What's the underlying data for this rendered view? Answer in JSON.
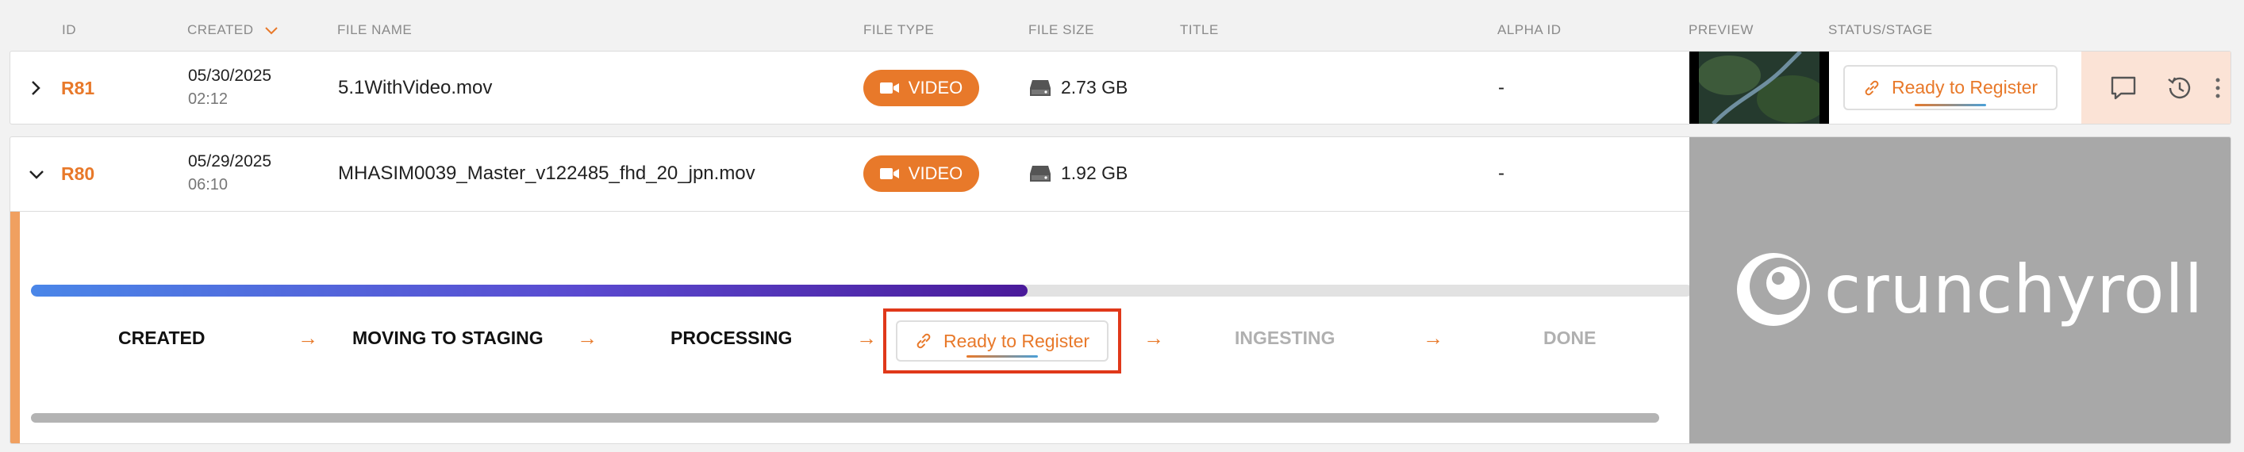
{
  "headers": {
    "id": "ID",
    "created": "CREATED",
    "file_name": "FILE NAME",
    "file_type": "FILE TYPE",
    "file_size": "FILE SIZE",
    "title": "TITLE",
    "alpha_id": "ALPHA ID",
    "preview": "PREVIEW",
    "status": "STATUS/STAGE",
    "sort_icon": "chevron-down-icon"
  },
  "rows": [
    {
      "id": "R81",
      "date": "05/30/2025",
      "time": "02:12",
      "file_name": "5.1WithVideo.mov",
      "file_type": "VIDEO",
      "file_size": "2.73 GB",
      "title": "",
      "alpha_id": "-",
      "status": "Ready to Register",
      "expanded": false
    },
    {
      "id": "R80",
      "date": "05/29/2025",
      "time": "06:10",
      "file_name": "MHASIM0039_Master_v122485_fhd_20_jpn.mov",
      "file_type": "VIDEO",
      "file_size": "1.92 GB",
      "title": "",
      "alpha_id": "-",
      "expanded": true
    }
  ],
  "pipeline": {
    "progress": 0.6,
    "stages": [
      {
        "label": "CREATED",
        "state": "done"
      },
      {
        "label": "MOVING TO STAGING",
        "state": "done"
      },
      {
        "label": "PROCESSING",
        "state": "done"
      },
      {
        "label": "Ready to Register",
        "state": "current"
      },
      {
        "label": "INGESTING",
        "state": "pending"
      },
      {
        "label": "DONE",
        "state": "pending"
      }
    ]
  },
  "brand": {
    "logo_text": "crunchyroll"
  },
  "colors": {
    "accent": "#e8792a",
    "highlight": "#e0381a",
    "progress_start": "#4a86e8",
    "progress_end": "#4a1a9a"
  }
}
